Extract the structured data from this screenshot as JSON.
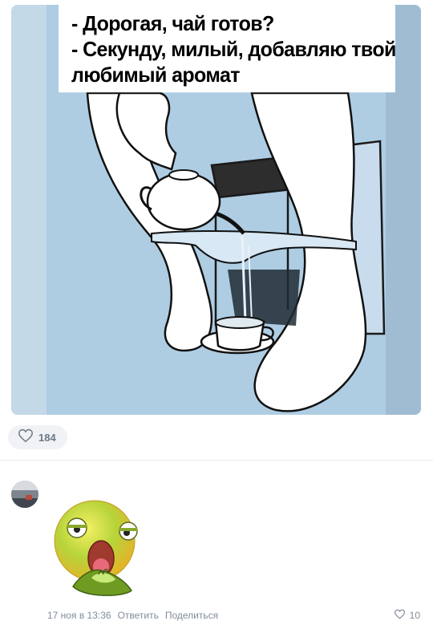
{
  "post": {
    "caption_lines": [
      "- Дорогая, чай готов?",
      "- Секунду, милый, добавляю твой",
      "любимый аромат"
    ],
    "likes": "184"
  },
  "comment": {
    "date": "17 ноя в 13:36",
    "reply_label": "Ответить",
    "share_label": "Поделиться",
    "likes": "10"
  },
  "icons": {
    "like": "heart-icon",
    "avatar": "user-avatar",
    "sticker": "vomiting-smiley-sticker"
  },
  "colors": {
    "image_background": "#aecde3",
    "pill_background": "#f0f2f5",
    "meta_text": "#818c99"
  }
}
